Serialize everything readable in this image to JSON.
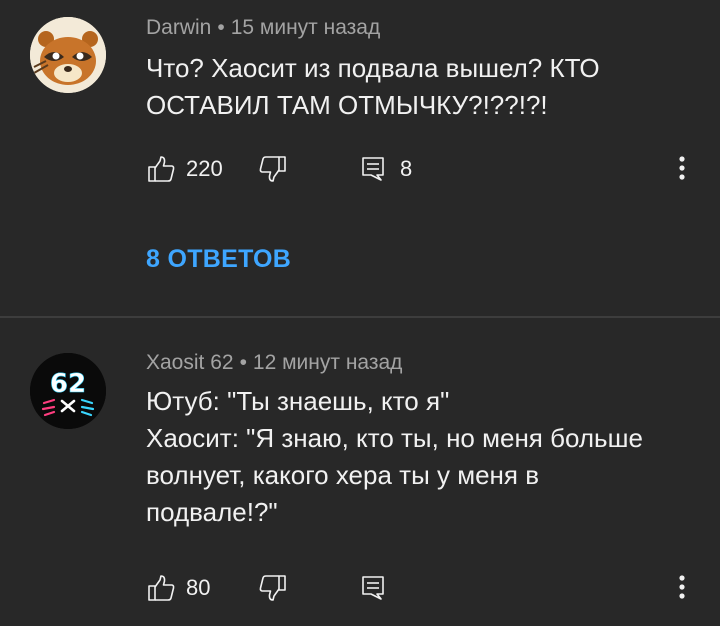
{
  "comments": [
    {
      "author": "Darwin",
      "time": "15 минут назад",
      "text_lines": [
        "Что? Хаосит из подвала  вышел? КТО",
        "ОСТАВИЛ ТАМ ОТМЫЧКУ?!??!?!"
      ],
      "likes": "220",
      "replies_count": "8",
      "replies_link": "8 ОТВЕТОВ",
      "avatar": "raccoon-face-icon"
    },
    {
      "author": "Xaosit 62",
      "time": "12 минут назад",
      "text_lines": [
        "Ютуб: \"Ты знаешь, кто я\"",
        "Хаосит: \"Я знаю, кто ты, но меня больше",
        "волнует, какого хера ты у меня в",
        "подвале!?\""
      ],
      "likes": "80",
      "avatar_text": "62",
      "avatar": "cat-62-logo-icon"
    }
  ],
  "separator": "•",
  "colors": {
    "background": "#282828",
    "text": "#f1f1f1",
    "meta": "#a3a3a3",
    "link": "#3ea6ff",
    "divider": "#3d3d3d"
  }
}
